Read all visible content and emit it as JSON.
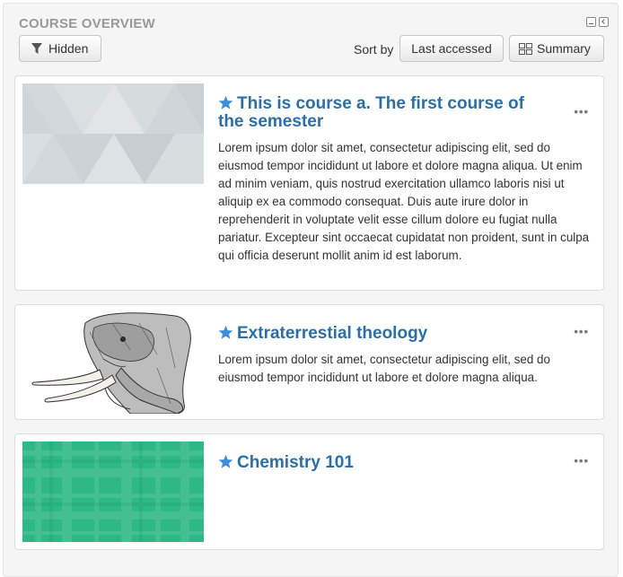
{
  "block": {
    "title": "COURSE OVERVIEW"
  },
  "toolbar": {
    "filter_label": "Hidden",
    "sort_by_label": "Sort by",
    "sort_value": "Last accessed",
    "view_label": "Summary"
  },
  "courses": [
    {
      "title": "This is course a. The first course of the semester",
      "summary": "Lorem ipsum dolor sit amet, consectetur adipiscing elit, sed do eiusmod tempor incididunt ut labore et dolore magna aliqua. Ut enim ad minim veniam, quis nostrud exercitation ullamco laboris nisi ut aliquip ex ea commodo consequat. Duis aute irure dolor in reprehenderit in voluptate velit esse cillum dolore eu fugiat nulla pariatur. Excepteur sint occaecat cupidatat non proident, sunt in culpa qui officia deserunt mollit anim id est laborum.",
      "starred": true,
      "menu": "•••"
    },
    {
      "title": "Extraterrestial theology",
      "summary": "Lorem ipsum dolor sit amet, consectetur adipiscing elit, sed do eiusmod tempor incididunt ut labore et dolore magna aliqua.",
      "starred": true,
      "menu": "•••"
    },
    {
      "title": "Chemistry 101",
      "summary": "",
      "starred": true,
      "menu": "•••"
    }
  ],
  "colors": {
    "link": "#2a6fa8",
    "star": "#3a8fd6",
    "chem_green": "#2db886"
  }
}
